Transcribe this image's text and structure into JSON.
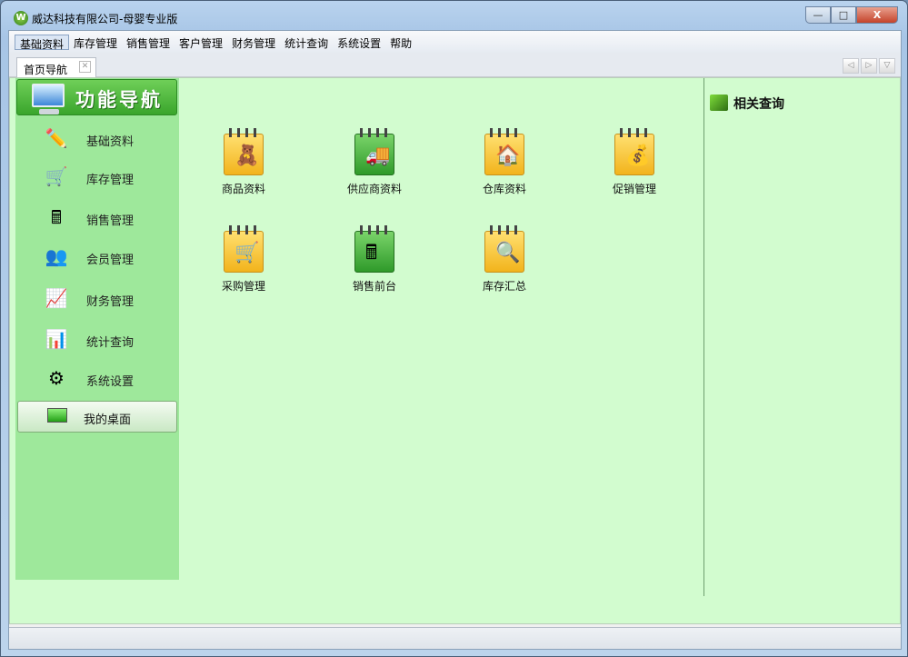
{
  "window": {
    "title": "威达科技有限公司-母婴专业版",
    "logo": "W",
    "minimize": "—",
    "maximize": "□",
    "close": "X"
  },
  "menu": [
    "基础资料",
    "库存管理",
    "销售管理",
    "客户管理",
    "财务管理",
    "统计查询",
    "系统设置",
    "帮助"
  ],
  "tab": {
    "label": "首页导航",
    "close": "✕"
  },
  "tab_nav": {
    "prev": "◁",
    "next": "▷",
    "down": "▽"
  },
  "sidebar": {
    "header": "功能导航",
    "items": [
      {
        "label": "基础资料",
        "icon": "pencil-icon",
        "glyph": "✏️"
      },
      {
        "label": "库存管理",
        "icon": "cart-icon",
        "glyph": "🛒"
      },
      {
        "label": "销售管理",
        "icon": "cash-register-icon",
        "glyph": "🖩"
      },
      {
        "label": "会员管理",
        "icon": "users-icon",
        "glyph": "👥"
      },
      {
        "label": "财务管理",
        "icon": "finance-chart-icon",
        "glyph": "📈"
      },
      {
        "label": "统计查询",
        "icon": "statistics-icon",
        "glyph": "📊"
      },
      {
        "label": "系统设置",
        "icon": "gears-icon",
        "glyph": "⚙"
      }
    ],
    "desktop": "我的桌面"
  },
  "functions": [
    {
      "label": "商品资料",
      "icon": "product-icon",
      "glyph": "🧸",
      "color": "yellow"
    },
    {
      "label": "供应商资料",
      "icon": "truck-icon",
      "glyph": "🚚",
      "color": "green"
    },
    {
      "label": "仓库资料",
      "icon": "warehouse-icon",
      "glyph": "🏠",
      "color": "yellow"
    },
    {
      "label": "促销管理",
      "icon": "promotion-icon",
      "glyph": "💰",
      "color": "yellow"
    },
    {
      "label": "采购管理",
      "icon": "purchase-cart-icon",
      "glyph": "🛒",
      "color": "yellow"
    },
    {
      "label": "销售前台",
      "icon": "pos-icon",
      "glyph": "🖩",
      "color": "green"
    },
    {
      "label": "库存汇总",
      "icon": "inventory-summary-icon",
      "glyph": "🔍",
      "color": "yellow"
    }
  ],
  "related": {
    "title": "相关查询"
  }
}
